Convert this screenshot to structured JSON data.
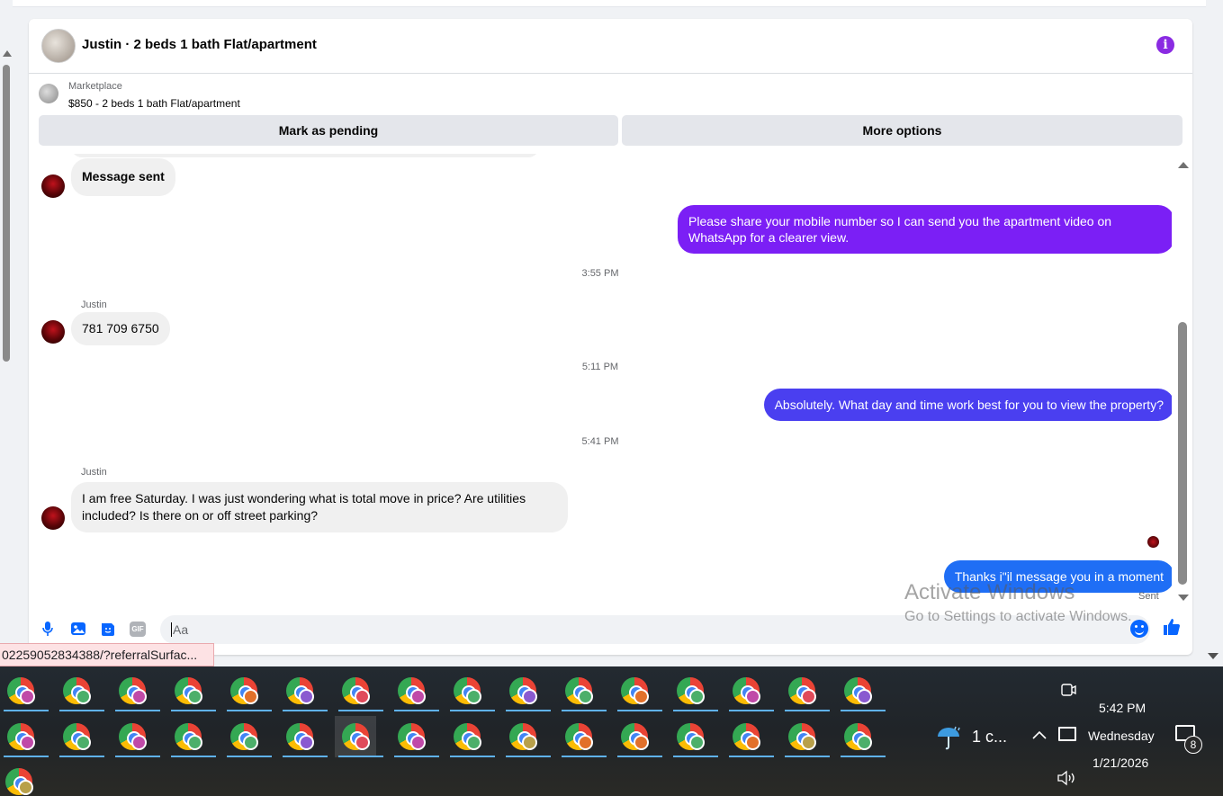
{
  "header": {
    "title": "Justin · 2 beds 1 bath Flat/apartment",
    "info_icon": "info-icon"
  },
  "listing": {
    "source": "Marketplace",
    "price_title": "$850 - 2 beds 1 bath Flat/apartment"
  },
  "actions": {
    "pending_label": "Mark as pending",
    "more_label": "More options"
  },
  "messages": {
    "m1": "Message sent",
    "m2": "Please share your mobile number so I can send you the apartment video on WhatsApp for a clearer view.",
    "t1": "3:55 PM",
    "sender1": "Justin",
    "m3": "781 709 6750",
    "t2": "5:11 PM",
    "m4": "Absolutely. What day and time work best for you to view the property?",
    "t3": "5:41 PM",
    "sender2": "Justin",
    "m5": "I am free Saturday. I was just wondering what is total move in price? Are utilities included? Is there on or off street parking?",
    "m6": "Thanks i\"il message you in a moment",
    "status": "Sent"
  },
  "watermark": {
    "line1": "Activate Windows",
    "line2": "Go to Settings to activate Windows."
  },
  "composer": {
    "placeholder": "Aa",
    "gif_label": "GIF"
  },
  "status_url": "02259052834388/?referralSurfac...",
  "taskbar": {
    "weather": "1 c...",
    "time": "5:42 PM",
    "day": "Wednesday",
    "date": "1/21/2026",
    "notifications": "8"
  },
  "colors": {
    "accent_purple": "#8a2be2",
    "bubble_violet": "#7b1ff5",
    "bubble_indigo": "#4a3ff0",
    "bubble_blue": "#1f6ef5"
  }
}
